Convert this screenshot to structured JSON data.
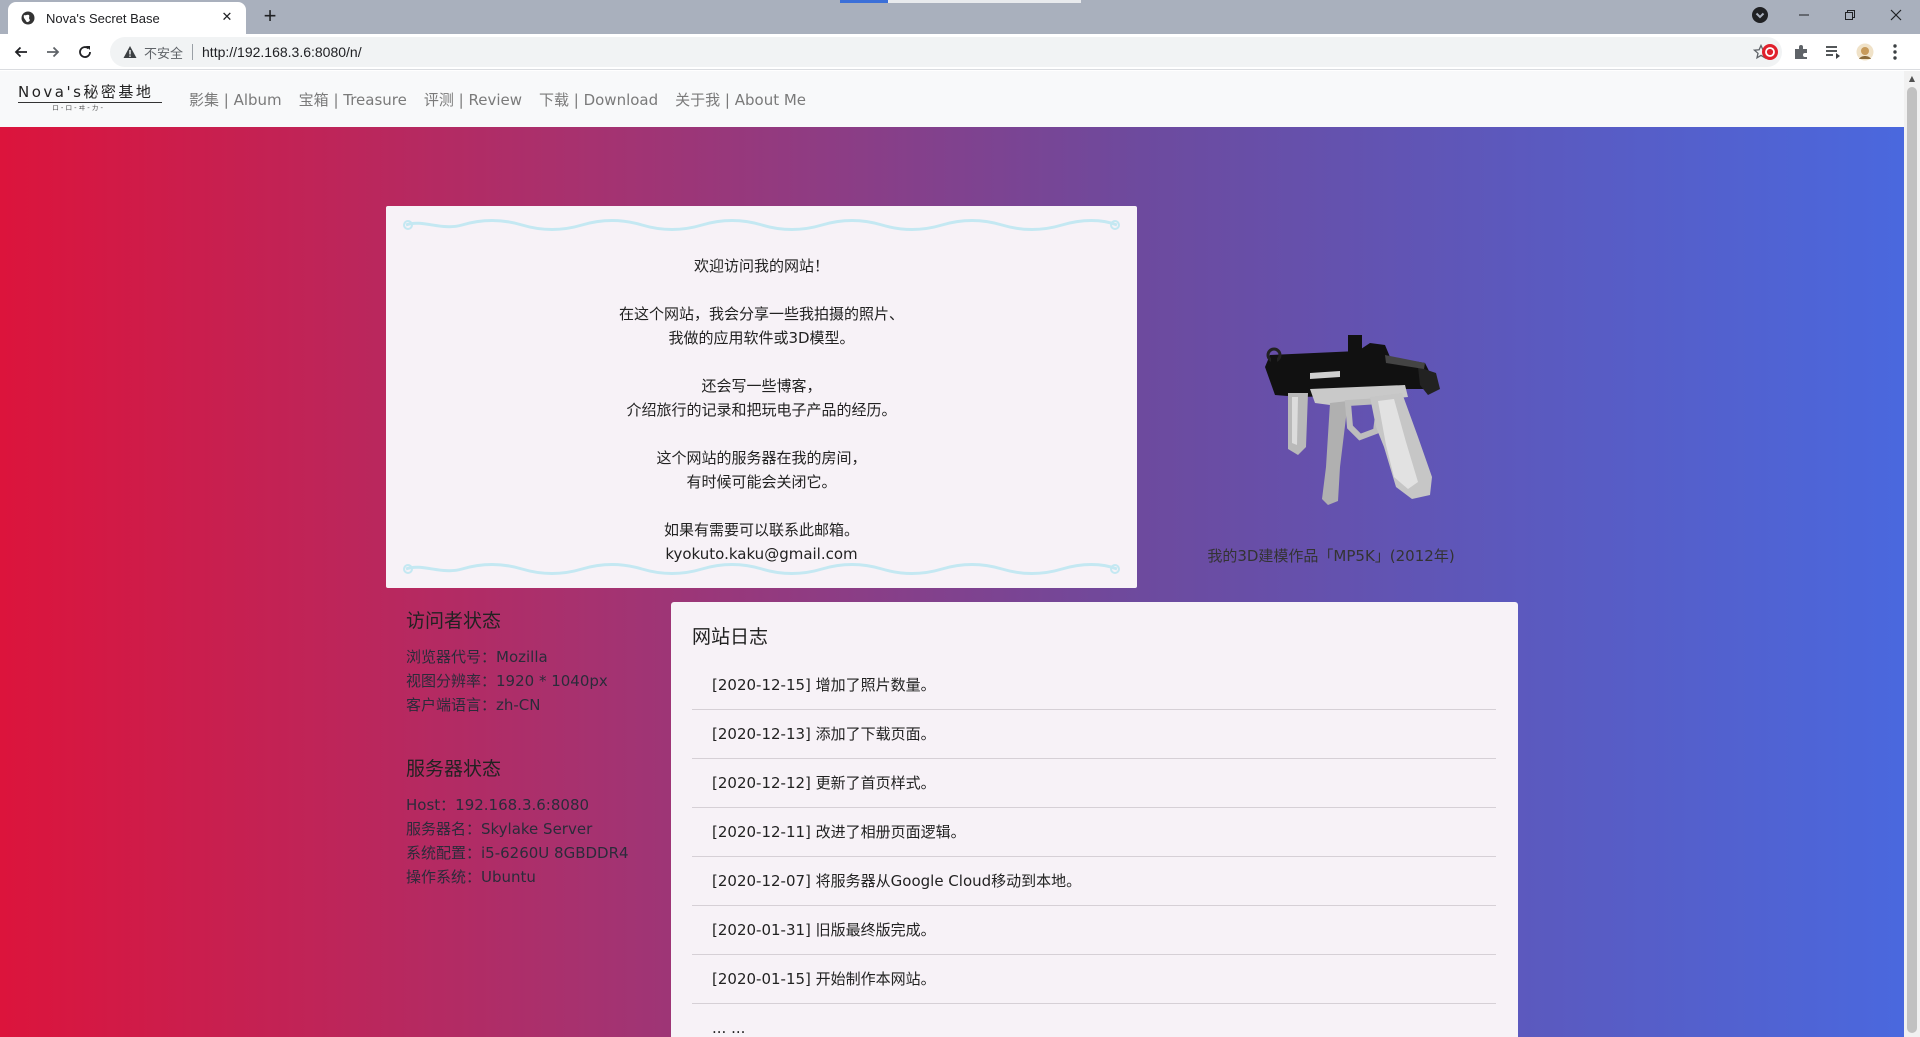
{
  "browser": {
    "tab_title": "Nova's Secret Base",
    "tab_close": "✕",
    "new_tab": "+",
    "insecure_label": "不安全",
    "url": "http://192.168.3.6:8080/n/"
  },
  "site": {
    "brand_title": "Nova's秘密基地",
    "brand_sub": "ロ-ロ-ヰ-カ-",
    "nav": [
      {
        "label": "影集 | Album"
      },
      {
        "label": "宝箱 | Treasure"
      },
      {
        "label": "评测 | Review"
      },
      {
        "label": "下载 | Download"
      },
      {
        "label": "关于我 | About Me"
      }
    ]
  },
  "welcome": {
    "greeting": "欢迎访问我的网站！",
    "p2_line1": "在这个网站，我会分享一些我拍摄的照片、",
    "p2_line2": "我做的应用软件或3D模型。",
    "p3_line1": "还会写一些博客，",
    "p3_line2": "介绍旅行的记录和把玩电子产品的经历。",
    "p4_line1": "这个网站的服务器在我的房间，",
    "p4_line2": "有时候可能会关闭它。",
    "p5_line1": "如果有需要可以联系此邮箱。",
    "email": "kyokuto.kaku@gmail.com"
  },
  "model": {
    "caption": "我的3D建模作品「MP5K」(2012年)"
  },
  "visitor": {
    "title": "访问者状态",
    "lines": [
      "浏览器代号：Mozilla",
      "视图分辨率：1920 * 1040px",
      "客户端语言：zh-CN"
    ]
  },
  "server": {
    "title": "服务器状态",
    "lines": [
      "Host：192.168.3.6:8080",
      "服务器名：Skylake Server",
      "系统配置：i5-6260U 8GBDDR4",
      "操作系统：Ubuntu"
    ]
  },
  "log": {
    "title": "网站日志",
    "items": [
      "[2020-12-15] 增加了照片数量。",
      "[2020-12-13] 添加了下载页面。",
      "[2020-12-12] 更新了首页样式。",
      "[2020-12-11] 改进了相册页面逻辑。",
      "[2020-12-07] 将服务器从Google Cloud移动到本地。",
      "[2020-01-31] 旧版最终版完成。",
      "[2020-01-15] 开始制作本网站。",
      "... ..."
    ]
  },
  "colors": {
    "gradient_start": "#dc143c",
    "gradient_end": "#4a68de",
    "card_bg": "#f7f2f7",
    "navbar_bg": "#f8f9fa"
  }
}
